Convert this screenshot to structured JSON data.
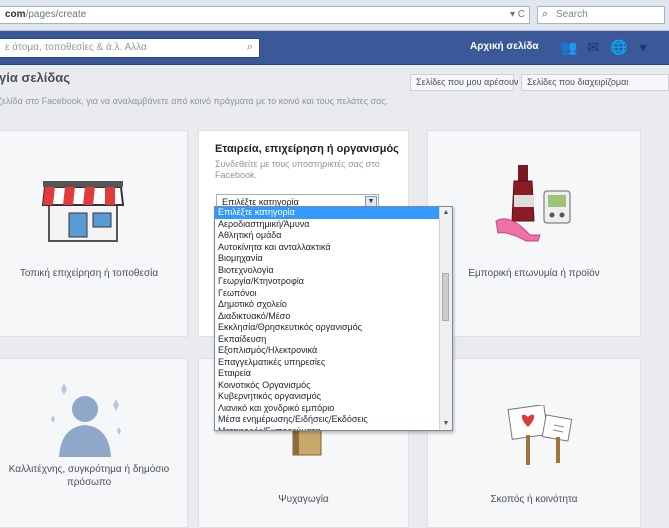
{
  "browser": {
    "url_prefix": "com",
    "url_rest": "/pages/create",
    "url_tools": "▾ C",
    "search_placeholder": "Search"
  },
  "fb_bar": {
    "search_placeholder": "ε άτομα, τοποθεσίες & ά.λ. Αλλα",
    "user_label": "Αρχική σελίδα"
  },
  "header": {
    "title": "γία σελίδας",
    "subtitle": "ζελίδα στο Facebook, για να αναλαμβάνετε από κοινό πράγματα με το κοινό και τους πελάτες σας.",
    "btn_settings": "Σελίδες που μου αρέσουν",
    "btn_manage": "Σελίδες που διαχειρίζομαι"
  },
  "cards": {
    "local_business": "Τοπική επιχείρηση ή τοποθεσία",
    "company": {
      "title": "Εταιρεία, επιχείρηση ή οργανισμός",
      "desc": "Συνδεθείτε με τους υποστηρικτές σας στο Facebook.",
      "select_value": "Επιλέξτε κατηγορία"
    },
    "brand": "Εμπορική επωνυμία ή προϊόν",
    "artist": "Καλλιτέχνης, συγκρότημα ή δημόσιο πρόσωπο",
    "entertainment": "Ψυχαγωγία",
    "cause": "Σκοπός ή κοινότητα"
  },
  "dropdown": {
    "items": [
      "Επιλέξτε κατηγορία",
      "Αεροδιαστημική/Άμυνα",
      "Αθλητική ομάδα",
      "Αυτοκίνητα και ανταλλακτικά",
      "Βιομηχανία",
      "Βιοτεχνολογία",
      "Γεωργία/Κτηνοτροφία",
      "Γεωπόνοι",
      "Δημοτικό σχολείο",
      "Διαδικτυακό/Μέσο",
      "Εκκλησία/Θρησκευτικός οργανισμός",
      "Εκπαίδευση",
      "Εξοπλισμός/Ηλεκτρονικά",
      "Επαγγελματικές υπηρεσίες",
      "Εταιρεία",
      "Κοινοτικός Οργανισμός",
      "Κυβερνητικός οργανισμός",
      "Λιανικό και χονδρικό εμπόριο",
      "Μέσα ενημέρωσης/Ειδήσεις/Εκδόσεις",
      "Μεταφορές/Εμπορεύματα"
    ]
  },
  "colors": {
    "fb_blue": "#3b5998",
    "selection_blue": "#3399ff"
  }
}
